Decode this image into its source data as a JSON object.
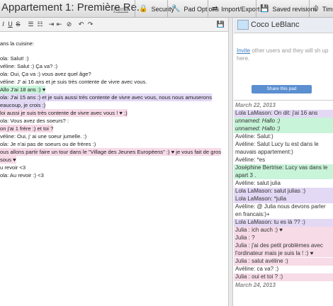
{
  "header": {
    "title": "Appartement 1: Première Re...",
    "rename": "(rena",
    "tabs": [
      {
        "icon": "lock-icon",
        "glyph": "🔒",
        "label": "Security"
      },
      {
        "icon": "wrench-icon",
        "glyph": "🔧",
        "label": "Pad Options"
      },
      {
        "icon": "arrows-icon",
        "glyph": "⇄",
        "label": "Import/Export"
      },
      {
        "icon": "save-icon",
        "glyph": "💾",
        "label": "Saved revisions"
      },
      {
        "icon": "timeslider-icon",
        "glyph": "⏱",
        "label": "Time"
      }
    ]
  },
  "toolbar": {
    "buttons": [
      "I",
      "U",
      "S",
      "☰",
      "☷",
      "⇥",
      "⇤",
      "⊘",
      "↶",
      "↷",
      "💾"
    ]
  },
  "editor": {
    "lines": [
      {
        "text": "ans la cuisine:",
        "hl": ""
      },
      {
        "text": "",
        "hl": ""
      },
      {
        "text": "ola: Salut! :)",
        "hl": ""
      },
      {
        "text": "véline: Salut :) Ça va? :)",
        "hl": ""
      },
      {
        "text": "ola: Oui, Ça va :) vous avez quel âge?",
        "hl": ""
      },
      {
        "text": "véline: J' ai 16 ans et je suis très contente de vivre avec vous.",
        "hl": ""
      },
      {
        "text": "Allo  J'ai 18 ans :) ♥",
        "hl": "hl-green"
      },
      {
        "text": "ola: J'ai 15 ans :) et je suis aussi très contente de vivre avec vous, nous nous amuserons",
        "hl": "hl-purple"
      },
      {
        "text": "eaucoup, je crois :)",
        "hl": "hl-purple"
      },
      {
        "text": "loi aussi je suis très contente de vivre avec vous ! ♥ ;)",
        "hl": "hl-pink"
      },
      {
        "text": "ola: Vous avez des soeurs? :",
        "hl": ""
      },
      {
        "text": "on j'ai 1 frère :) et toi ?",
        "hl": "hl-pink"
      },
      {
        "text": "véline: Oui, j' ai une soeur jumelle. :)",
        "hl": ""
      },
      {
        "text": "ola: Je n'ai pas de soeurs ou de frères :)",
        "hl": ""
      },
      {
        "text": "ous allons partir faire un tour dans le \"Village des Jeunes Européens\" :) ♥ je vous fait de gros",
        "hl": "hl-pink"
      },
      {
        "text": "sous ♥",
        "hl": "hl-pink"
      },
      {
        "text": "u revoir <3",
        "hl": ""
      },
      {
        "text": "ola: Au revoir :) <3",
        "hl": ""
      }
    ]
  },
  "user": {
    "name": "Coco LeBlanc"
  },
  "invite": {
    "link": "Invite",
    "text": " other users and they will sh up here."
  },
  "share_button": "Share this pad",
  "chat": {
    "items": [
      {
        "type": "date",
        "text": "March 22, 2013",
        "hl": ""
      },
      {
        "type": "msg",
        "text": "Lola LaMason: On dit: j'ai 16 ans",
        "hl": "hl-purple",
        "italic": false
      },
      {
        "type": "msg",
        "text": "unnamed: Hallo :)",
        "hl": "hl-green",
        "italic": true
      },
      {
        "type": "msg",
        "text": "unnamed: Hallo :)",
        "hl": "hl-green",
        "italic": true
      },
      {
        "type": "msg",
        "text": "Avéline: Salut:)",
        "hl": "",
        "italic": false
      },
      {
        "type": "msg",
        "text": "Avéline: Salut Lucy tu est dans le mauvais appartement:)",
        "hl": "",
        "italic": false
      },
      {
        "type": "msg",
        "text": "Avéline: *es",
        "hl": "",
        "italic": false
      },
      {
        "type": "msg",
        "text": "Joséphine Bertrise: Lucy vas dans le apart 3 .",
        "hl": "hl-green",
        "italic": false
      },
      {
        "type": "msg",
        "text": "Avéline: salut julia",
        "hl": "",
        "italic": false
      },
      {
        "type": "msg",
        "text": "Lola LaMason: salut julias :)",
        "hl": "hl-purple",
        "italic": false
      },
      {
        "type": "msg",
        "text": "Lola LaMason: *julia",
        "hl": "hl-purple",
        "italic": false
      },
      {
        "type": "msg",
        "text": "Avéline: @ Julia nous devons parler en francais:)+",
        "hl": "",
        "italic": false
      },
      {
        "type": "msg",
        "text": "Lola LaMason: tu es là ?? :)",
        "hl": "hl-purple",
        "italic": false
      },
      {
        "type": "msg",
        "text": "Julia : ich auch :) ♥",
        "hl": "hl-pink",
        "italic": false
      },
      {
        "type": "msg",
        "text": "Julia : ?",
        "hl": "hl-pink",
        "italic": false
      },
      {
        "type": "msg",
        "text": "Julia : j'ai des petit problèmes avec l'ordinateur mais je suis la ! :) ♥",
        "hl": "hl-pink",
        "italic": false
      },
      {
        "type": "msg",
        "text": "Julia : salut avéline :)",
        "hl": "hl-pink",
        "italic": false
      },
      {
        "type": "msg",
        "text": "Avéline: ca va? :)",
        "hl": "",
        "italic": false
      },
      {
        "type": "msg",
        "text": "Julia : oui et toi ? :)",
        "hl": "hl-pink",
        "italic": false
      },
      {
        "type": "date",
        "text": "March 24, 2013",
        "hl": ""
      }
    ]
  }
}
